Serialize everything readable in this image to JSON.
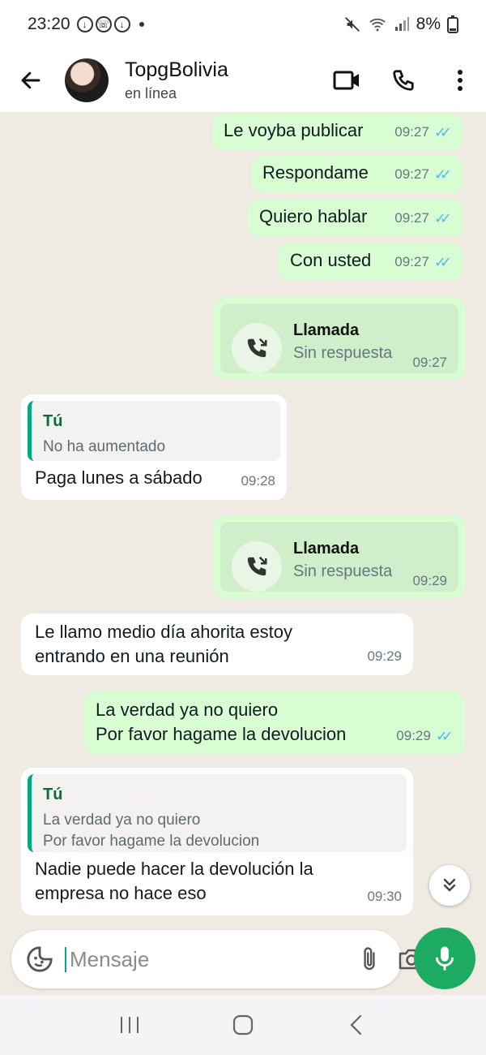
{
  "status_bar": {
    "time": "23:20",
    "battery": "8%"
  },
  "header": {
    "contact_name": "TopgBolivia",
    "contact_status": "en línea"
  },
  "messages": [
    {
      "type": "out",
      "text": "Le voyba publicar",
      "time": "09:27"
    },
    {
      "type": "out",
      "text": "Respondame",
      "time": "09:27"
    },
    {
      "type": "out",
      "text": "Quiero hablar",
      "time": "09:27"
    },
    {
      "type": "out",
      "text": "Con usted",
      "time": "09:27"
    },
    {
      "type": "call_out",
      "title": "Llamada",
      "subtitle": "Sin respuesta",
      "time": "09:27"
    },
    {
      "type": "in_reply",
      "quote_author": "Tú",
      "quote_text": "No ha aumentado",
      "text": "Paga lunes a sábado",
      "time": "09:28"
    },
    {
      "type": "call_out",
      "title": "Llamada",
      "subtitle": "Sin respuesta",
      "time": "09:29"
    },
    {
      "type": "in",
      "text_line1": "Le llamo medio día ahorita estoy",
      "text_line2": "entrando en una reunión",
      "time": "09:29"
    },
    {
      "type": "out",
      "text_line1": "La verdad ya no quiero",
      "text_line2": "Por favor hagame la devolucion",
      "time": "09:29"
    },
    {
      "type": "in_reply",
      "quote_author": "Tú",
      "quote_line1": "La verdad ya no quiero",
      "quote_line2": "Por favor hagame la devolucion",
      "text_line1": "Nadie puede hacer la devolución la",
      "text_line2": "empresa no hace eso",
      "time": "09:30"
    }
  ],
  "input": {
    "placeholder": "Mensaje"
  },
  "icons": {
    "back": "arrow-left-icon",
    "video": "video-call-icon",
    "phone": "phone-icon",
    "menu": "more-vertical-icon",
    "sticker": "sticker-icon",
    "attach": "paperclip-icon",
    "camera": "camera-icon",
    "mic": "microphone-icon",
    "scroll": "double-chevron-down-icon",
    "missed_call": "missed-call-icon"
  },
  "colors": {
    "outgoing_bubble": "#d9fdd3",
    "incoming_bubble": "#ffffff",
    "accent": "#1daa61",
    "read_tick": "#53bdeb",
    "chat_bg": "#efeae2"
  }
}
